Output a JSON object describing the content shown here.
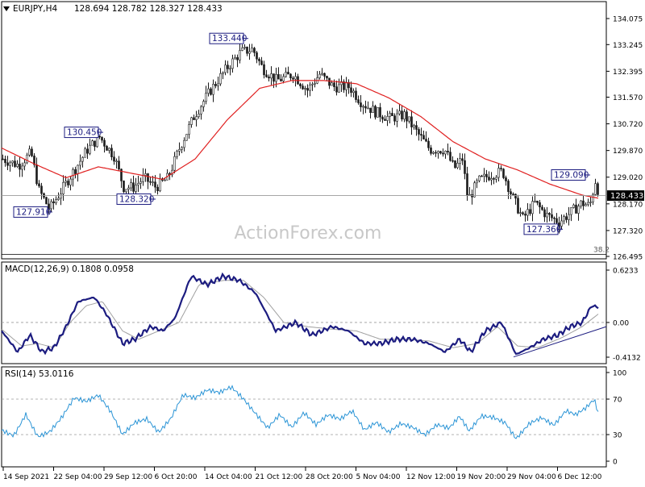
{
  "header": {
    "symbol": "EURJPY,H4",
    "ohlc": "128.694 128.782 128.327 128.433"
  },
  "watermark": "ActionForex.com",
  "colors": {
    "candle": "#1a1a1a",
    "ma": "#e02020",
    "macd": "#1c1c80",
    "signal": "#a0a0a0",
    "rsi": "#2a94d6",
    "label_border": "#1c1c80",
    "label_text": "#1c1c80",
    "grid": "#e6e6e6",
    "level_line": "#8c8c8c",
    "trendline": "#1c1c80"
  },
  "chart_data": [
    {
      "type": "candlestick",
      "panel": "price",
      "title": "EURJPY,H4",
      "ylim": [
        126.495,
        134.075
      ],
      "yticks": [
        "134.075",
        "133.245",
        "132.395",
        "131.570",
        "130.720",
        "129.870",
        "129.020",
        "128.170",
        "127.320",
        "126.495"
      ],
      "current_price": "128.433",
      "fib_label": "38.2",
      "fib_level": 126.56,
      "moving_average_anchors": [
        {
          "x": 0,
          "y": 129.95
        },
        {
          "x": 40,
          "y": 129.45
        },
        {
          "x": 80,
          "y": 129.0
        },
        {
          "x": 120,
          "y": 129.35
        },
        {
          "x": 160,
          "y": 129.15
        },
        {
          "x": 200,
          "y": 128.95
        },
        {
          "x": 240,
          "y": 129.6
        },
        {
          "x": 280,
          "y": 130.85
        },
        {
          "x": 320,
          "y": 131.85
        },
        {
          "x": 360,
          "y": 132.1
        },
        {
          "x": 400,
          "y": 132.1
        },
        {
          "x": 440,
          "y": 132.0
        },
        {
          "x": 480,
          "y": 131.55
        },
        {
          "x": 520,
          "y": 130.95
        },
        {
          "x": 560,
          "y": 130.15
        },
        {
          "x": 600,
          "y": 129.6
        },
        {
          "x": 640,
          "y": 129.25
        },
        {
          "x": 680,
          "y": 128.8
        },
        {
          "x": 720,
          "y": 128.45
        },
        {
          "x": 740,
          "y": 128.35
        }
      ],
      "close_anchors": [
        {
          "x": 0,
          "y": 129.6
        },
        {
          "x": 20,
          "y": 129.4
        },
        {
          "x": 35,
          "y": 129.8
        },
        {
          "x": 45,
          "y": 128.6
        },
        {
          "x": 58,
          "y": 128.0
        },
        {
          "x": 68,
          "y": 128.4
        },
        {
          "x": 85,
          "y": 129.1
        },
        {
          "x": 105,
          "y": 129.9
        },
        {
          "x": 120,
          "y": 130.3
        },
        {
          "x": 138,
          "y": 129.7
        },
        {
          "x": 150,
          "y": 128.7
        },
        {
          "x": 162,
          "y": 128.7
        },
        {
          "x": 175,
          "y": 129.0
        },
        {
          "x": 190,
          "y": 128.7
        },
        {
          "x": 205,
          "y": 129.0
        },
        {
          "x": 220,
          "y": 130.0
        },
        {
          "x": 238,
          "y": 131.0
        },
        {
          "x": 258,
          "y": 131.8
        },
        {
          "x": 278,
          "y": 132.5
        },
        {
          "x": 295,
          "y": 133.0
        },
        {
          "x": 310,
          "y": 133.1
        },
        {
          "x": 322,
          "y": 132.5
        },
        {
          "x": 340,
          "y": 132.1
        },
        {
          "x": 360,
          "y": 132.3
        },
        {
          "x": 378,
          "y": 131.8
        },
        {
          "x": 393,
          "y": 132.3
        },
        {
          "x": 410,
          "y": 131.9
        },
        {
          "x": 430,
          "y": 131.9
        },
        {
          "x": 445,
          "y": 131.4
        },
        {
          "x": 462,
          "y": 131.1
        },
        {
          "x": 480,
          "y": 130.9
        },
        {
          "x": 498,
          "y": 131.0
        },
        {
          "x": 515,
          "y": 130.4
        },
        {
          "x": 530,
          "y": 129.9
        },
        {
          "x": 548,
          "y": 129.9
        },
        {
          "x": 560,
          "y": 129.3
        },
        {
          "x": 570,
          "y": 129.6
        },
        {
          "x": 577,
          "y": 128.3
        },
        {
          "x": 590,
          "y": 128.9
        },
        {
          "x": 605,
          "y": 129.1
        },
        {
          "x": 620,
          "y": 129.2
        },
        {
          "x": 632,
          "y": 128.4
        },
        {
          "x": 645,
          "y": 127.7
        },
        {
          "x": 660,
          "y": 128.2
        },
        {
          "x": 675,
          "y": 127.8
        },
        {
          "x": 690,
          "y": 127.6
        },
        {
          "x": 705,
          "y": 127.9
        },
        {
          "x": 718,
          "y": 128.2
        },
        {
          "x": 728,
          "y": 128.1
        },
        {
          "x": 735,
          "y": 128.9
        },
        {
          "x": 740,
          "y": 128.45
        }
      ],
      "labels": [
        {
          "text": "133.440",
          "x": 300,
          "y": 133.44,
          "anchor": "left"
        },
        {
          "text": "130.450",
          "x": 120,
          "y": 130.45,
          "anchor": "left"
        },
        {
          "text": "128.320",
          "x": 185,
          "y": 128.32,
          "anchor": "left"
        },
        {
          "text": "127.910",
          "x": 57,
          "y": 127.91,
          "anchor": "left"
        },
        {
          "text": "129.090",
          "x": 724,
          "y": 129.09,
          "anchor": "left"
        },
        {
          "text": "127.360",
          "x": 690,
          "y": 127.36,
          "anchor": "left"
        }
      ]
    },
    {
      "type": "line",
      "panel": "macd",
      "title": "MACD(12,26,9) 0.1808 0.0958",
      "ylim": [
        -0.4132,
        0.6233
      ],
      "yticks": [
        "0.6233",
        "0.00",
        "-0.4132"
      ],
      "macd_anchors": [
        {
          "x": 0,
          "y": -0.1
        },
        {
          "x": 20,
          "y": -0.35
        },
        {
          "x": 35,
          "y": -0.15
        },
        {
          "x": 50,
          "y": -0.35
        },
        {
          "x": 65,
          "y": -0.3
        },
        {
          "x": 80,
          "y": -0.05
        },
        {
          "x": 95,
          "y": 0.25
        },
        {
          "x": 115,
          "y": 0.3
        },
        {
          "x": 130,
          "y": 0.1
        },
        {
          "x": 150,
          "y": -0.25
        },
        {
          "x": 165,
          "y": -0.2
        },
        {
          "x": 185,
          "y": -0.05
        },
        {
          "x": 200,
          "y": -0.1
        },
        {
          "x": 215,
          "y": 0.05
        },
        {
          "x": 235,
          "y": 0.55
        },
        {
          "x": 255,
          "y": 0.45
        },
        {
          "x": 275,
          "y": 0.55
        },
        {
          "x": 295,
          "y": 0.5
        },
        {
          "x": 315,
          "y": 0.35
        },
        {
          "x": 340,
          "y": -0.1
        },
        {
          "x": 365,
          "y": 0.0
        },
        {
          "x": 385,
          "y": -0.15
        },
        {
          "x": 410,
          "y": -0.05
        },
        {
          "x": 430,
          "y": -0.1
        },
        {
          "x": 450,
          "y": -0.25
        },
        {
          "x": 470,
          "y": -0.25
        },
        {
          "x": 490,
          "y": -0.2
        },
        {
          "x": 510,
          "y": -0.2
        },
        {
          "x": 530,
          "y": -0.25
        },
        {
          "x": 550,
          "y": -0.35
        },
        {
          "x": 568,
          "y": -0.2
        },
        {
          "x": 582,
          "y": -0.35
        },
        {
          "x": 600,
          "y": -0.1
        },
        {
          "x": 620,
          "y": 0.0
        },
        {
          "x": 638,
          "y": -0.38
        },
        {
          "x": 655,
          "y": -0.3
        },
        {
          "x": 672,
          "y": -0.2
        },
        {
          "x": 690,
          "y": -0.15
        },
        {
          "x": 705,
          "y": -0.05
        },
        {
          "x": 720,
          "y": 0.0
        },
        {
          "x": 732,
          "y": 0.2
        },
        {
          "x": 740,
          "y": 0.18
        }
      ],
      "signal_anchors": [
        {
          "x": 0,
          "y": -0.08
        },
        {
          "x": 25,
          "y": -0.28
        },
        {
          "x": 45,
          "y": -0.25
        },
        {
          "x": 65,
          "y": -0.3
        },
        {
          "x": 85,
          "y": 0.0
        },
        {
          "x": 105,
          "y": 0.2
        },
        {
          "x": 125,
          "y": 0.25
        },
        {
          "x": 150,
          "y": -0.1
        },
        {
          "x": 170,
          "y": -0.2
        },
        {
          "x": 200,
          "y": -0.08
        },
        {
          "x": 220,
          "y": 0.0
        },
        {
          "x": 245,
          "y": 0.45
        },
        {
          "x": 275,
          "y": 0.5
        },
        {
          "x": 300,
          "y": 0.5
        },
        {
          "x": 325,
          "y": 0.3
        },
        {
          "x": 350,
          "y": 0.0
        },
        {
          "x": 380,
          "y": -0.05
        },
        {
          "x": 410,
          "y": -0.08
        },
        {
          "x": 440,
          "y": -0.1
        },
        {
          "x": 470,
          "y": -0.2
        },
        {
          "x": 500,
          "y": -0.2
        },
        {
          "x": 530,
          "y": -0.22
        },
        {
          "x": 560,
          "y": -0.3
        },
        {
          "x": 590,
          "y": -0.25
        },
        {
          "x": 615,
          "y": -0.05
        },
        {
          "x": 640,
          "y": -0.28
        },
        {
          "x": 665,
          "y": -0.3
        },
        {
          "x": 695,
          "y": -0.18
        },
        {
          "x": 720,
          "y": -0.05
        },
        {
          "x": 740,
          "y": 0.1
        }
      ],
      "trendline": [
        {
          "x": 635,
          "y": -0.41
        },
        {
          "x": 750,
          "y": -0.05
        }
      ]
    },
    {
      "type": "line",
      "panel": "rsi",
      "title": "RSI(14) 53.0116",
      "ylim": [
        0,
        100
      ],
      "yticks": [
        "100",
        "70",
        "30",
        "0"
      ],
      "levels": [
        70,
        30
      ],
      "rsi_anchors": [
        {
          "x": 0,
          "y": 35
        },
        {
          "x": 15,
          "y": 30
        },
        {
          "x": 30,
          "y": 55
        },
        {
          "x": 45,
          "y": 30
        },
        {
          "x": 60,
          "y": 35
        },
        {
          "x": 75,
          "y": 50
        },
        {
          "x": 90,
          "y": 70
        },
        {
          "x": 105,
          "y": 65
        },
        {
          "x": 120,
          "y": 72
        },
        {
          "x": 135,
          "y": 55
        },
        {
          "x": 150,
          "y": 30
        },
        {
          "x": 165,
          "y": 45
        },
        {
          "x": 180,
          "y": 50
        },
        {
          "x": 195,
          "y": 35
        },
        {
          "x": 210,
          "y": 50
        },
        {
          "x": 225,
          "y": 75
        },
        {
          "x": 240,
          "y": 70
        },
        {
          "x": 255,
          "y": 78
        },
        {
          "x": 270,
          "y": 75
        },
        {
          "x": 285,
          "y": 82
        },
        {
          "x": 300,
          "y": 70
        },
        {
          "x": 315,
          "y": 55
        },
        {
          "x": 330,
          "y": 40
        },
        {
          "x": 345,
          "y": 55
        },
        {
          "x": 360,
          "y": 40
        },
        {
          "x": 375,
          "y": 55
        },
        {
          "x": 390,
          "y": 40
        },
        {
          "x": 405,
          "y": 50
        },
        {
          "x": 420,
          "y": 45
        },
        {
          "x": 435,
          "y": 55
        },
        {
          "x": 450,
          "y": 35
        },
        {
          "x": 465,
          "y": 45
        },
        {
          "x": 480,
          "y": 35
        },
        {
          "x": 495,
          "y": 45
        },
        {
          "x": 510,
          "y": 40
        },
        {
          "x": 525,
          "y": 30
        },
        {
          "x": 540,
          "y": 40
        },
        {
          "x": 555,
          "y": 35
        },
        {
          "x": 568,
          "y": 48
        },
        {
          "x": 580,
          "y": 32
        },
        {
          "x": 595,
          "y": 50
        },
        {
          "x": 610,
          "y": 50
        },
        {
          "x": 625,
          "y": 45
        },
        {
          "x": 638,
          "y": 28
        },
        {
          "x": 655,
          "y": 45
        },
        {
          "x": 670,
          "y": 50
        },
        {
          "x": 685,
          "y": 40
        },
        {
          "x": 700,
          "y": 55
        },
        {
          "x": 712,
          "y": 50
        },
        {
          "x": 725,
          "y": 58
        },
        {
          "x": 735,
          "y": 68
        },
        {
          "x": 740,
          "y": 53
        }
      ]
    }
  ],
  "x_axis": {
    "labels": [
      "14 Sep 2021",
      "22 Sep 04:00",
      "29 Sep 12:00",
      "6 Oct 20:00",
      "14 Oct 04:00",
      "21 Oct 12:00",
      "28 Oct 20:00",
      "5 Nov 04:00",
      "12 Nov 12:00",
      "19 Nov 20:00",
      "29 Nov 04:00",
      "6 Dec 12:00"
    ]
  }
}
